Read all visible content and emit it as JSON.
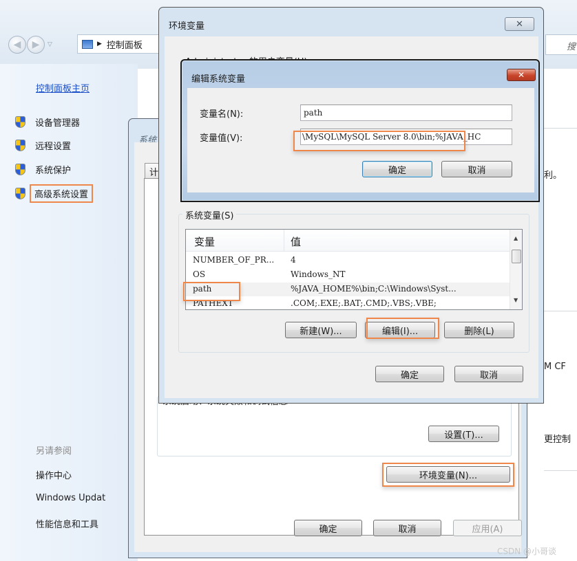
{
  "control_panel": {
    "breadcrumb": "控制面板",
    "search_placeholder": "搜",
    "home_link": "控制面板主页",
    "side_items": [
      {
        "label": "设备管理器",
        "icon": "uac-shield-icon"
      },
      {
        "label": "远程设置",
        "icon": "uac-shield-icon"
      },
      {
        "label": "系统保护",
        "icon": "uac-shield-icon"
      },
      {
        "label": "高级系统设置",
        "icon": "uac-shield-icon",
        "highlighted": true
      }
    ],
    "see_also_title": "另请参阅",
    "see_also_links": [
      "操作中心",
      "Windows Updat",
      "性能信息和工具"
    ],
    "right_fragments": [
      "利。",
      "M CF",
      "更控制"
    ]
  },
  "system_properties": {
    "title": "系统",
    "tab_label": "计",
    "startup_group_text": "系统启动、系统失败和调试信息",
    "settings_button": "设置(T)...",
    "env_vars_button": "环境变量(N)...",
    "ok_button": "确定",
    "cancel_button": "取消",
    "apply_button": "应用(A)"
  },
  "env_window": {
    "title": "环境变量",
    "close_label": "✕",
    "user_vars_label": "Administrator 的用户变量(U)",
    "system_vars_label": "系统变量(S)",
    "columns": [
      "变量",
      "值"
    ],
    "rows": [
      {
        "name": "NUMBER_OF_PR...",
        "value": "4"
      },
      {
        "name": "OS",
        "value": "Windows_NT"
      },
      {
        "name": "path",
        "value": "%JAVA_HOME%\\bin;C:\\Windows\\Syst...",
        "selected": true
      },
      {
        "name": "PATHEXT",
        "value": ".COM;.EXE;.BAT;.CMD;.VBS;.VBE;"
      }
    ],
    "new_button": "新建(W)...",
    "edit_button": "编辑(I)...",
    "delete_button": "删除(L)",
    "ok_button": "确定",
    "cancel_button": "取消"
  },
  "edit_dialog": {
    "title": "编辑系统变量",
    "close_label": "✕",
    "name_label": "变量名(N):",
    "name_value": "path",
    "value_label": "变量值(V):",
    "value_value": "\\MySQL\\MySQL Server 8.0\\bin;%JAVA_HC",
    "ok_button": "确定",
    "cancel_button": "取消"
  },
  "highlight_color": "#f0874a",
  "watermark": "CSDN @小哥谈"
}
